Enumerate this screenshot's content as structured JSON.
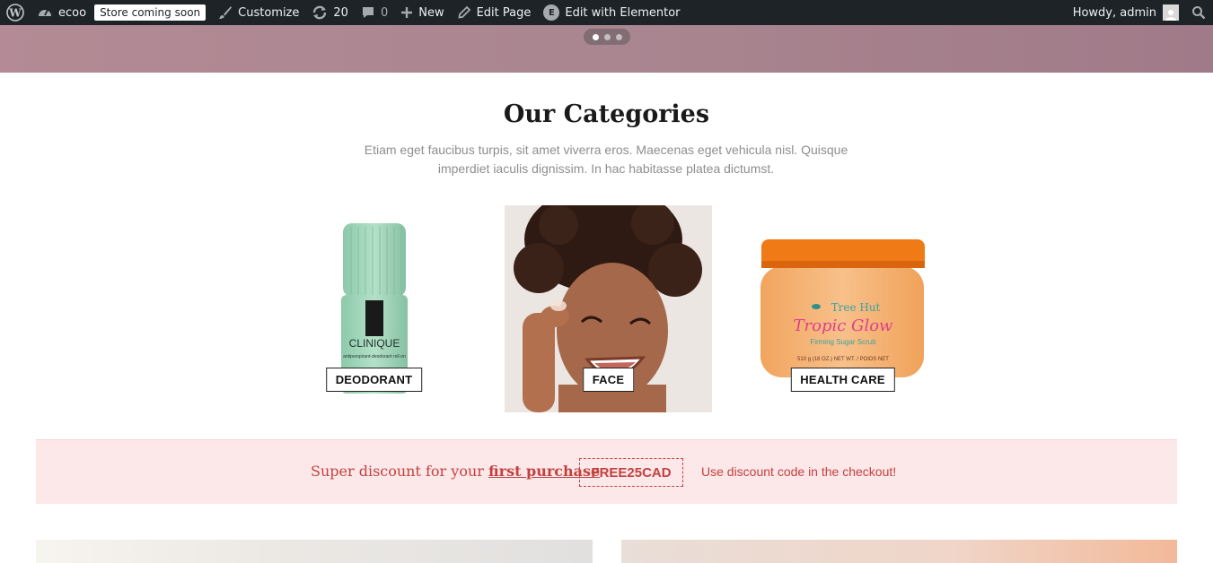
{
  "adminbar": {
    "site_name": "ecoo",
    "store_badge": "Store coming soon",
    "customize": "Customize",
    "updates_count": "20",
    "comments_count": "0",
    "new": "New",
    "edit_page": "Edit Page",
    "edit_elementor": "Edit with Elementor",
    "howdy": "Howdy, admin"
  },
  "slider": {
    "active_dot": 1,
    "dots": 3
  },
  "categories": {
    "title": "Our Categories",
    "description": "Etiam eget faucibus turpis, sit amet viverra eros. Maecenas eget vehicula nisl. Quisque imperdiet iaculis dignissim. In hac habitasse platea dictumst.",
    "items": [
      {
        "label": "DEODORANT",
        "brand": "CLINIQUE",
        "brand_sub": "antiperspirant-deodorant roll-on"
      },
      {
        "label": "FACE"
      },
      {
        "label": "HEALTH CARE",
        "brand": "Tree Hut",
        "product": "Tropic Glow",
        "product_sub": "Firming Sugar Scrub",
        "weight": "510 g (18 OZ.) NET WT. / POIDS NET"
      }
    ]
  },
  "promo": {
    "text_before": "Super discount for your ",
    "text_link": "first purchase",
    "code": "FREE25CAD",
    "hint": "Use discount code in the checkout!"
  },
  "colors": {
    "adminbar_bg": "#1d2327",
    "promo_accent": "#c4403f",
    "promo_bg": "#fde8e9"
  }
}
